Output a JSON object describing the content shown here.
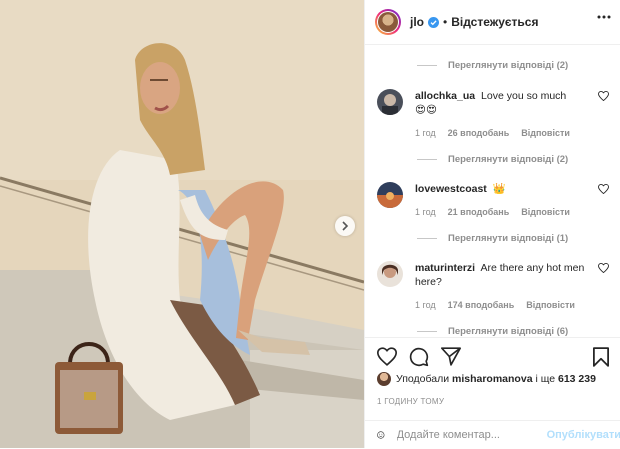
{
  "header": {
    "username": "jlo",
    "separator": "•",
    "follow_status": "Відстежується"
  },
  "view_replies": [
    {
      "label": "Переглянути відповіді (2)"
    },
    {
      "label": "Переглянути відповіді (2)"
    },
    {
      "label": "Переглянути відповіді (1)"
    },
    {
      "label": "Переглянути відповіді (6)"
    }
  ],
  "comments": [
    {
      "username": "allochka_ua",
      "text": "Love you so much",
      "emoji": "😍😍",
      "time": "1 год",
      "likes": "26 вподобань",
      "reply": "Відповісти"
    },
    {
      "username": "lovewestcoast",
      "text": "",
      "emoji": "👑",
      "time": "1 год",
      "likes": "21 вподобань",
      "reply": "Відповісти"
    },
    {
      "username": "maturinterzi",
      "text": "Are there any hot men here?",
      "emoji": "",
      "time": "1 год",
      "likes": "174 вподобань",
      "reply": "Відповісти"
    }
  ],
  "likes": {
    "prefix": "Уподобали",
    "user": "misharomanova",
    "suffix": "і ще",
    "count": "613 239"
  },
  "timestamp": "1 ГОДИНУ ТОМУ",
  "add_comment": {
    "placeholder": "Додайте коментар...",
    "publish": "Опублікувати"
  },
  "icons": {
    "verified": "verified-badge-icon",
    "more": "more-options-icon",
    "like": "heart-icon",
    "comment": "comment-icon",
    "share": "share-icon",
    "save": "bookmark-icon",
    "emoji": "smiley-icon",
    "next": "chevron-right-icon"
  },
  "colors": {
    "verified": "#3897f0",
    "publish_disabled": "#b2dffc",
    "muted": "#8e8e8e"
  }
}
